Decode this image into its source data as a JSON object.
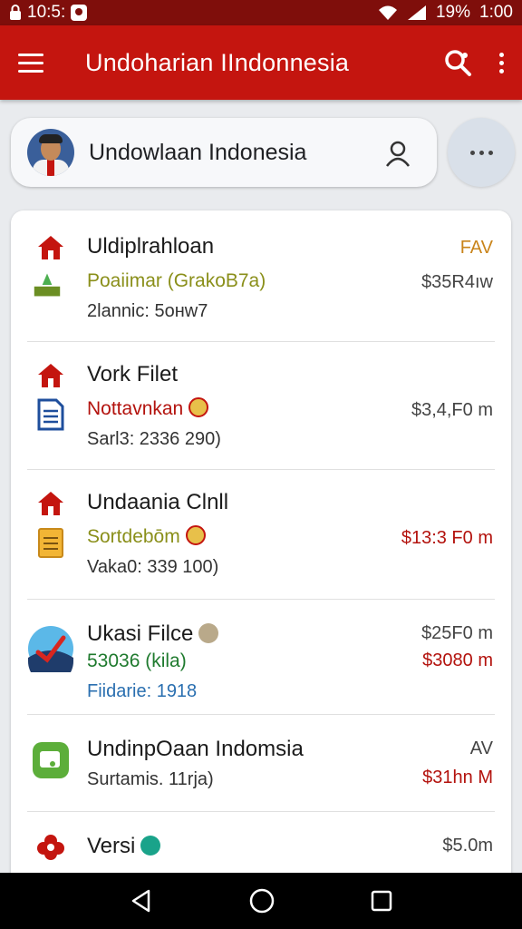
{
  "status_bar": {
    "time_left": "10:5:",
    "battery": "19%",
    "clock": "1:00"
  },
  "app_bar": {
    "title": "Undoharian IIndonnesia"
  },
  "search": {
    "label": "Undowlaan Indonesia"
  },
  "items": [
    {
      "title": "Uldiplrahloan",
      "subtitle": "Poaiimar (GrakoB7a)",
      "subtitle_color": "#8a8f1a",
      "detail": "2lannic: 5oнw7",
      "price1": "FAV",
      "price1_color": "#c9841a",
      "price2": "$35R4ıw",
      "price2_color": "#444444"
    },
    {
      "title": "Vork Filet",
      "subtitle": "Nottavnkan",
      "subtitle_color": "#b3120d",
      "detail": "Sarl3: 2336 290)",
      "price1": "$3,4,F0 m",
      "price1_color": "#444444"
    },
    {
      "title": "Undaania Clnll",
      "subtitle": "Sortdebōm",
      "subtitle_color": "#8a8f1a",
      "detail": "Vaka0: 339 100)",
      "price1": "$13:3 F0 m",
      "price1_color": "#b3120d"
    },
    {
      "title": "Ukasi Filce",
      "subtitle": "53036 (kila)",
      "subtitle_color": "#1f7a2e",
      "detail": "Fiidarie: 1918",
      "detail_color": "#2a6fb0",
      "price1": "$25F0 m",
      "price1_color": "#444444",
      "price2": "$3080 m",
      "price2_color": "#b3120d"
    },
    {
      "title": "UndinpOaan Indomsia",
      "subtitle": "Surtamis. 11rja)",
      "subtitle_color": "#333333",
      "price1": "AV",
      "price1_color": "#444444",
      "price2": "$31hn M",
      "price2_color": "#b3120d"
    },
    {
      "title": "Versi",
      "price1": "$5.0m",
      "price1_color": "#444444"
    }
  ],
  "colors": {
    "primary": "#c4150f",
    "status_bar": "#7f0e0b"
  },
  "icons": [
    "menu-icon",
    "search-settings-icon",
    "more-vert-icon",
    "user-icon",
    "more-horiz-icon",
    "home-icon",
    "document-icon",
    "back-icon",
    "home-nav-icon",
    "recents-icon"
  ]
}
